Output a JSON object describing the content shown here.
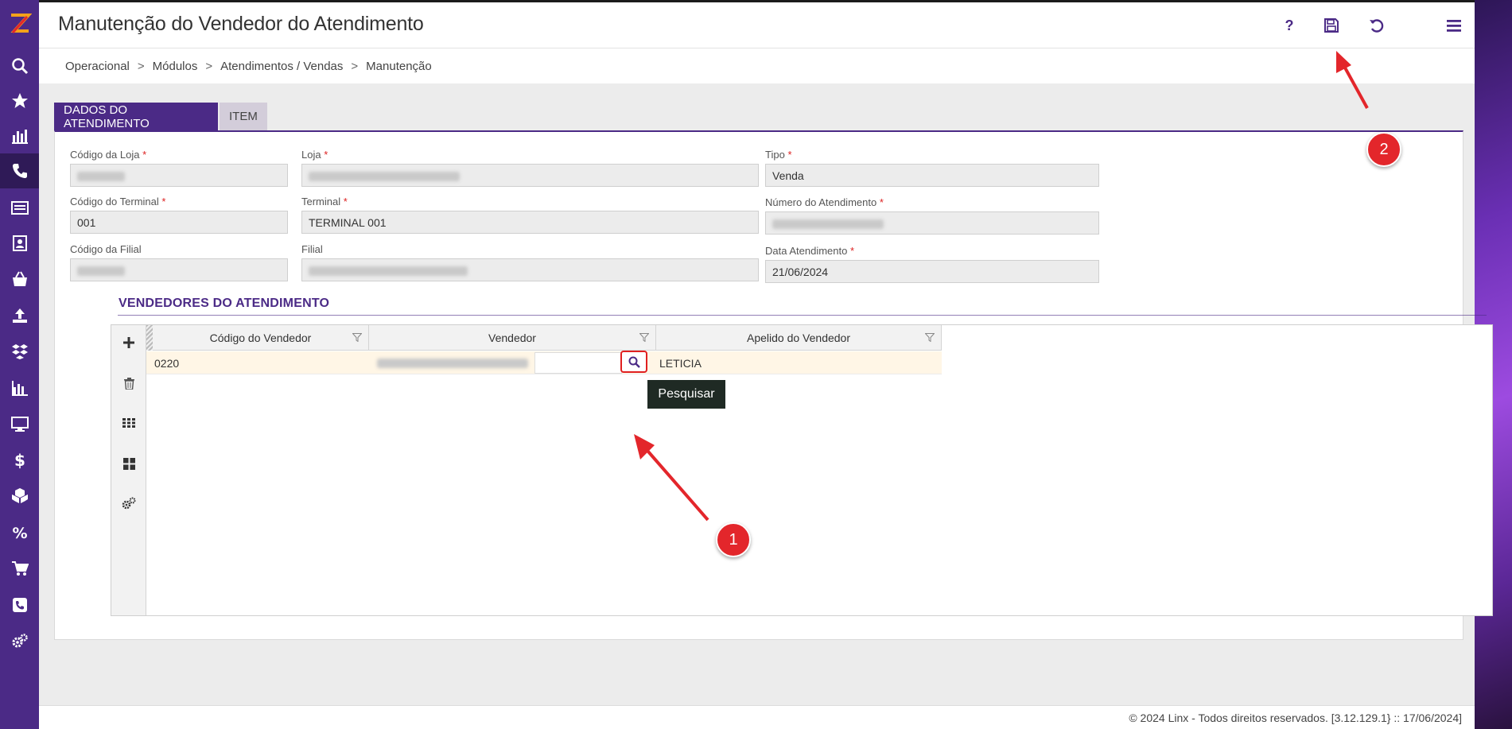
{
  "app": {
    "title": "Manutenção do Vendedor do Atendimento",
    "help_label": "?",
    "accent": "#4b2a86"
  },
  "breadcrumb": [
    "Operacional",
    "Módulos",
    "Atendimentos / Vendas",
    "Manutenção"
  ],
  "breadcrumb_separator": ">",
  "tabs": [
    {
      "label": "DADOS DO ATENDIMENTO",
      "active": true
    },
    {
      "label": "ITEM",
      "active": false
    }
  ],
  "form": {
    "codigo_loja": {
      "label": "Código da Loja",
      "required_mark": "*",
      "value": ""
    },
    "loja": {
      "label": "Loja",
      "required_mark": "*",
      "value": ""
    },
    "tipo": {
      "label": "Tipo",
      "required_mark": "*",
      "value": "Venda"
    },
    "codigo_terminal": {
      "label": "Código do Terminal",
      "required_mark": "*",
      "value": "001"
    },
    "terminal": {
      "label": "Terminal",
      "required_mark": "*",
      "value": "TERMINAL 001"
    },
    "numero_atendimento": {
      "label": "Número do Atendimento",
      "required_mark": "*",
      "value": ""
    },
    "codigo_filial": {
      "label": "Código da Filial",
      "value": ""
    },
    "filial": {
      "label": "Filial",
      "value": ""
    },
    "data_atendimento": {
      "label": "Data Atendimento",
      "required_mark": "*",
      "value": "21/06/2024"
    }
  },
  "section": {
    "title": "VENDEDORES DO ATENDIMENTO"
  },
  "grid": {
    "columns": [
      "Código do Vendedor",
      "Vendedor",
      "Apelido do Vendedor"
    ],
    "rows": [
      {
        "codigo": "0220",
        "vendedor": "",
        "apelido": "LETICIA"
      }
    ],
    "tools": [
      "plus-icon",
      "trash-icon",
      "grid-dots-icon",
      "tiles-icon",
      "gears-icon"
    ]
  },
  "tooltip": "Pesquisar",
  "annotations": {
    "badge_1": "1",
    "badge_2": "2"
  },
  "footer": "© 2024 Linx - Todos direitos reservados. [3.12.129.1} :: 17/06/2024]",
  "sidebar": {
    "icons": [
      "logo-icon",
      "search-icon",
      "star-icon",
      "bar-chart-icon",
      "phone-icon",
      "list-icon",
      "contact-icon",
      "basket-icon",
      "upload-icon",
      "boxes-icon",
      "report-icon",
      "monitor-icon",
      "dollar-icon",
      "cubes-icon",
      "percent-icon",
      "cart-icon",
      "phone-book-icon",
      "settings-icon"
    ]
  }
}
